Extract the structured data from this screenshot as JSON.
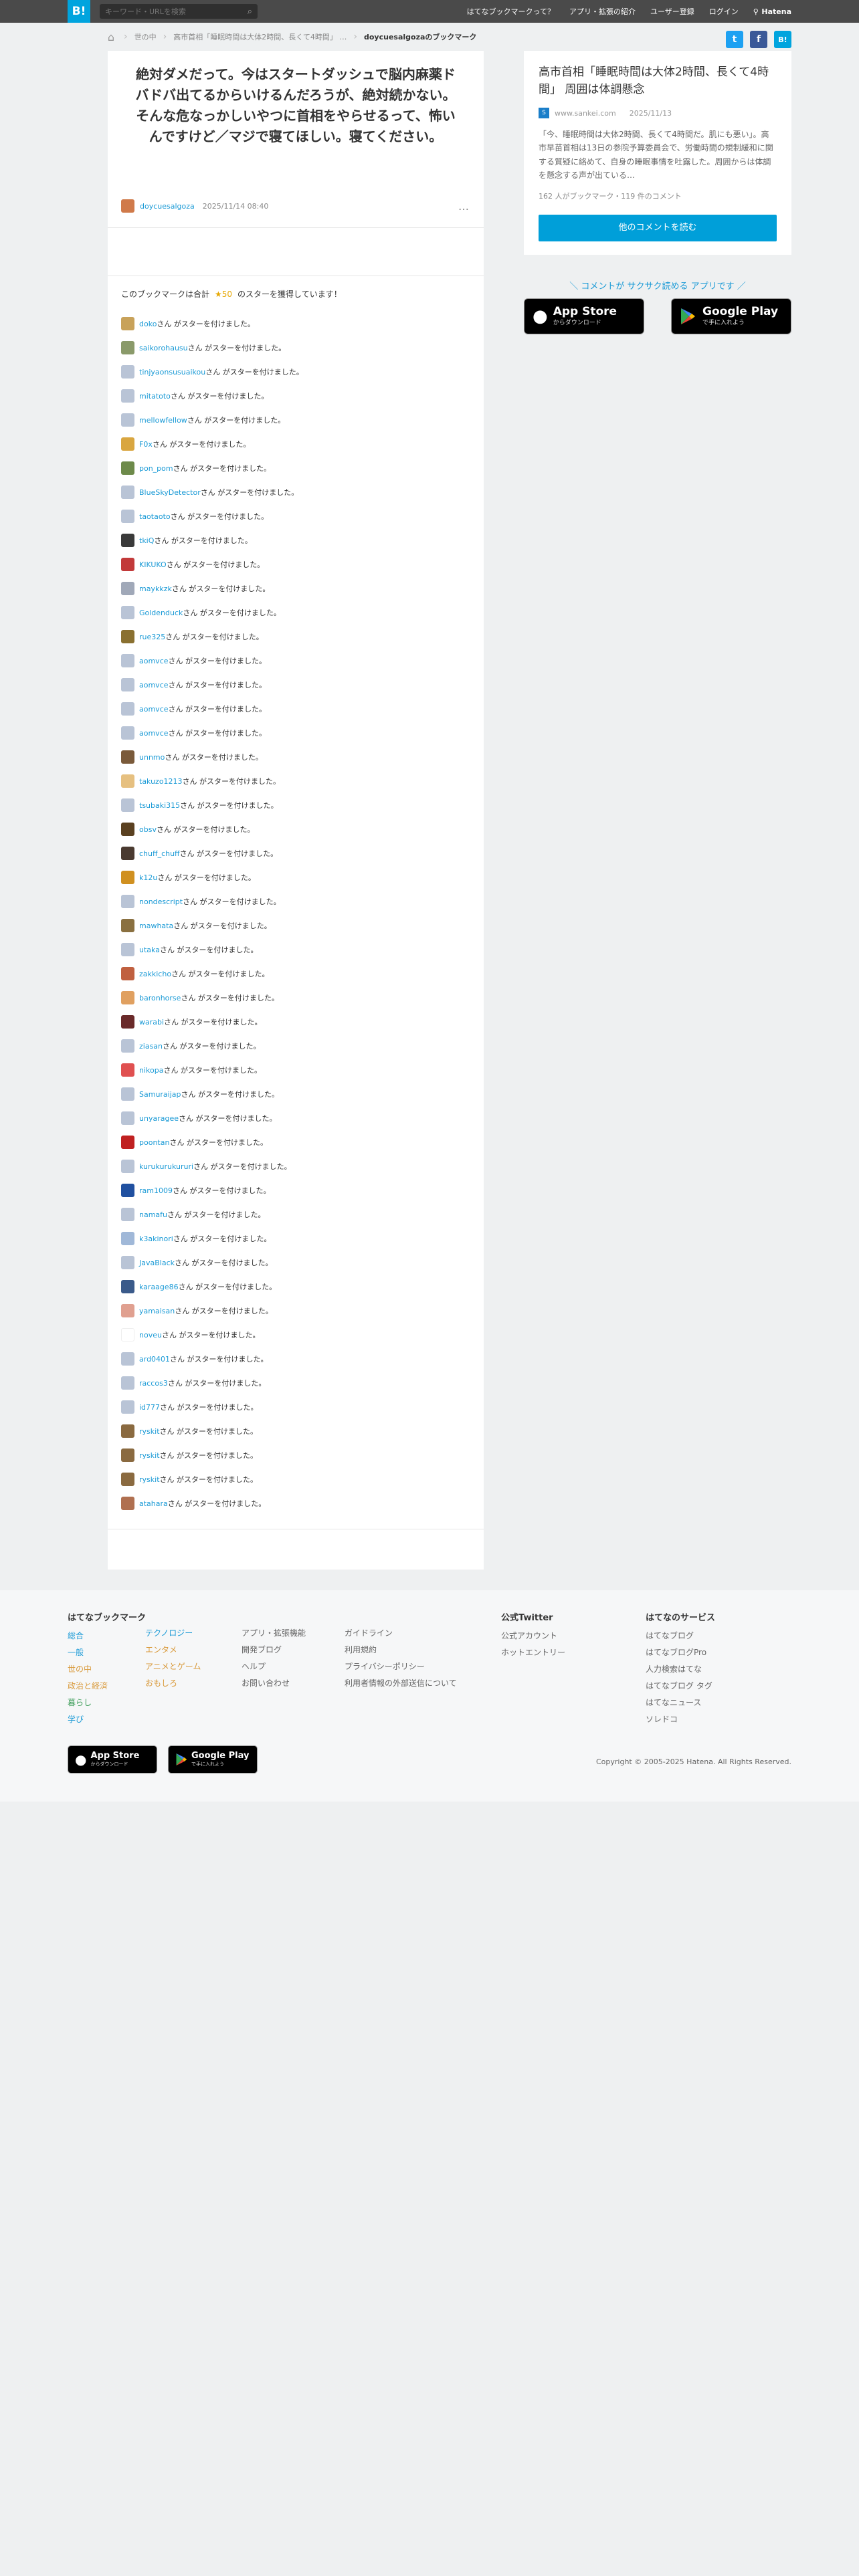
{
  "topbar": {
    "logo": "B!",
    "search_placeholder": "キーワード・URLを検索",
    "nav": [
      "はてなブックマークって？",
      "アプリ・拡張の紹介",
      "ユーザー登録",
      "ログイン"
    ],
    "brand": "Hatena"
  },
  "breadcrumb": {
    "items": [
      "世の中",
      "高市首相「睡眠時間は大体2時間、長くて4時間」 …",
      "doycuesalgozaのブックマーク"
    ]
  },
  "comment": {
    "text": "絶対ダメだって。今はスタートダッシュで脳内麻薬ドバドバ出てるからいけるんだろうが、絶対続かない。そんな危なっかしいやつに首相をやらせるって、怖いんですけど／マジで寝てほしい。寝てください。",
    "user": "doycuesalgoza",
    "date": "2025/11/14 08:40",
    "menu": "…"
  },
  "stars": {
    "summary_prefix": "このブックマークは合計",
    "summary_count": "★50",
    "summary_suffix": "のスターを獲得しています！",
    "suffix": "さん がスターを付けました。",
    "users": [
      {
        "name": "doko",
        "color": "#c8a25a"
      },
      {
        "name": "saikorohausu",
        "color": "#8a9a6a"
      },
      {
        "name": "tinjyaonsusuaikou",
        "color": "#b9c4d6"
      },
      {
        "name": "mitatoto",
        "color": "#b9c4d6"
      },
      {
        "name": "mellowfellow",
        "color": "#b9c4d6"
      },
      {
        "name": "F0x",
        "color": "#d9a640"
      },
      {
        "name": "pon_pom",
        "color": "#6d8a4a"
      },
      {
        "name": "BlueSkyDetector",
        "color": "#b9c4d6"
      },
      {
        "name": "taotaoto",
        "color": "#b9c4d6"
      },
      {
        "name": "tkiQ",
        "color": "#3a3a3a"
      },
      {
        "name": "KIKUKO",
        "color": "#c23a3a"
      },
      {
        "name": "maykkzk",
        "color": "#a0a8b8"
      },
      {
        "name": "Goldenduck",
        "color": "#b9c4d6"
      },
      {
        "name": "rue325",
        "color": "#8a7030"
      },
      {
        "name": "aomvce",
        "color": "#b9c4d6"
      },
      {
        "name": "aomvce",
        "color": "#b9c4d6"
      },
      {
        "name": "aomvce",
        "color": "#b9c4d6"
      },
      {
        "name": "aomvce",
        "color": "#b9c4d6"
      },
      {
        "name": "unnmo",
        "color": "#7a5a3a"
      },
      {
        "name": "takuzo1213",
        "color": "#e6c080"
      },
      {
        "name": "tsubaki315",
        "color": "#b9c4d6"
      },
      {
        "name": "obsv",
        "color": "#5a4020"
      },
      {
        "name": "chuff_chuff",
        "color": "#4a3a30"
      },
      {
        "name": "k12u",
        "color": "#d09020"
      },
      {
        "name": "nondescript",
        "color": "#b9c4d6"
      },
      {
        "name": "mawhata",
        "color": "#8a7040"
      },
      {
        "name": "utaka",
        "color": "#b9c4d6"
      },
      {
        "name": "zakkicho",
        "color": "#c06040"
      },
      {
        "name": "baronhorse",
        "color": "#e0a060"
      },
      {
        "name": "warabi",
        "color": "#6a2a2a"
      },
      {
        "name": "ziasan",
        "color": "#b9c4d6"
      },
      {
        "name": "nikopa",
        "color": "#e05050"
      },
      {
        "name": "Samuraijap",
        "color": "#b9c4d6"
      },
      {
        "name": "unyaragee",
        "color": "#b9c4d6"
      },
      {
        "name": "poontan",
        "color": "#c02020"
      },
      {
        "name": "kurukurukururi",
        "color": "#b9c4d6"
      },
      {
        "name": "ram1009",
        "color": "#2050a0"
      },
      {
        "name": "namafu",
        "color": "#b9c4d6"
      },
      {
        "name": "k3akinori",
        "color": "#a0b8d8"
      },
      {
        "name": "JavaBlack",
        "color": "#b9c4d6"
      },
      {
        "name": "karaage86",
        "color": "#3a5a8a"
      },
      {
        "name": "yamaisan",
        "color": "#e0a090"
      },
      {
        "name": "noveu",
        "color": "#ffffff"
      },
      {
        "name": "ard0401",
        "color": "#b9c4d6"
      },
      {
        "name": "raccos3",
        "color": "#b9c4d6"
      },
      {
        "name": "id777",
        "color": "#b9c4d6"
      },
      {
        "name": "ryskit",
        "color": "#8a6a40"
      },
      {
        "name": "ryskit",
        "color": "#8a6a40"
      },
      {
        "name": "ryskit",
        "color": "#8a6a40"
      },
      {
        "name": "atahara",
        "color": "#b07050"
      }
    ]
  },
  "entry": {
    "title": "高市首相「睡眠時間は大体2時間、長くて4時間」 周囲は体調懸念",
    "site": "www.sankei.com",
    "date": "2025/11/13",
    "description": "「今、睡眠時間は大体2時間、長くて4時間だ。肌にも悪い」。高市早苗首相は13日の参院予算委員会で、労働時間の規制緩和に関する質疑に絡めて、自身の睡眠事情を吐露した。周囲からは体調を懸念する声が出ている…",
    "stats": "162 人がブックマーク・119 件のコメント",
    "button": "他のコメントを読む"
  },
  "promo": {
    "text": "＼ コメントが サクサク読める アプリです ／",
    "appstore_small": "からダウンロード",
    "appstore_big": "App Store",
    "gplay_big": "Google Play",
    "gplay_small": "で手に入れよう"
  },
  "footer": {
    "title": "はてなブックマーク",
    "col1": [
      "総合",
      "一般",
      "世の中",
      "政治と経済",
      "暮らし",
      "学び"
    ],
    "col2": [
      "テクノロジー",
      "エンタメ",
      "アニメとゲーム",
      "おもしろ"
    ],
    "col3": [
      "アプリ・拡張機能",
      "開発ブログ",
      "ヘルプ",
      "お問い合わせ"
    ],
    "col4": [
      "ガイドライン",
      "利用規約",
      "プライバシーポリシー",
      "利用者情報の外部送信について"
    ],
    "twitter_title": "公式Twitter",
    "twitter": [
      "公式アカウント",
      "ホットエントリー"
    ],
    "services_title": "はてなのサービス",
    "services": [
      "はてなブログ",
      "はてなブログPro",
      "人力検索はてな",
      "はてなブログ タグ",
      "はてなニュース",
      "ソレドコ"
    ],
    "copyright": "Copyright © 2005-2025 Hatena. All Rights Reserved.",
    "appstore_small": "からダウンロード",
    "gplay_small": "で手に入れよう"
  },
  "colors": {
    "accent": "#00a4de",
    "link": "#1a9ad6",
    "button": "#009fd9",
    "star": "#e6a700"
  }
}
